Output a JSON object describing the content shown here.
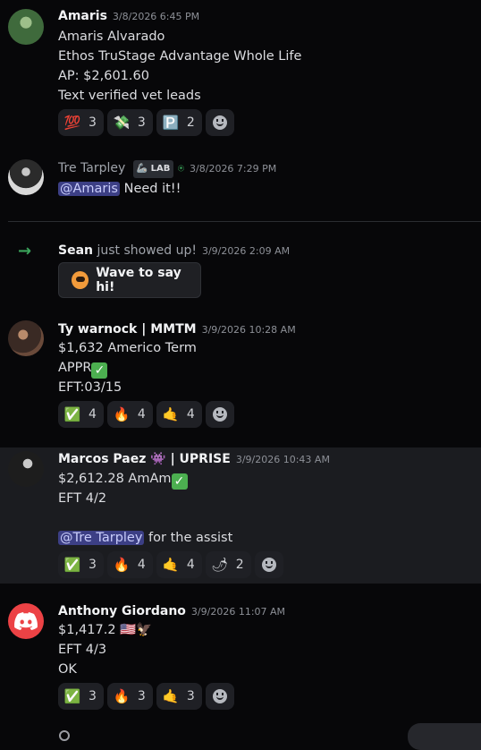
{
  "messages": [
    {
      "author": "Amaris",
      "timestamp": "3/8/2026 6:45 PM",
      "lines": [
        "Amaris Alvarado",
        "Ethos TruStage Advantage Whole Life",
        "AP: $2,601.60",
        "Text verified vet leads"
      ],
      "reactions": [
        {
          "emoji": "💯",
          "count": "3"
        },
        {
          "emoji": "💸",
          "count": "3"
        },
        {
          "emoji": "🅿️",
          "count": "2"
        }
      ]
    },
    {
      "author": "Tre Tarpley",
      "tag": "LAB",
      "timestamp": "3/8/2026 7:29 PM",
      "mention": "@Amaris",
      "text": "Need it!!"
    },
    {
      "author": "Sean",
      "system_text": "just showed up!",
      "timestamp": "3/9/2026 2:09 AM",
      "wave_button": "Wave to say hi!"
    },
    {
      "author": "Ty warnock | MMTM",
      "timestamp": "3/9/2026 10:28 AM",
      "lines": [
        "$1,632 Americo Term",
        "APPR",
        "EFT:03/15"
      ],
      "reactions": [
        {
          "emoji": "✅",
          "count": "4"
        },
        {
          "emoji": "🔥",
          "count": "4"
        },
        {
          "emoji": "🤙",
          "count": "4"
        }
      ]
    },
    {
      "author": "Marcos Paez 👾 | UPRISE",
      "timestamp": "3/9/2026 10:43 AM",
      "lines": [
        "$2,612.28 AmAm",
        "EFT 4/2"
      ],
      "mention": "@Tre Tarpley",
      "mention_suffix": "for the assist",
      "reactions": [
        {
          "emoji": "✅",
          "count": "3"
        },
        {
          "emoji": "🔥",
          "count": "4"
        },
        {
          "emoji": "🤙",
          "count": "4"
        },
        {
          "emoji": "🌶",
          "count": "2"
        }
      ]
    },
    {
      "author": "Anthony Giordano",
      "timestamp": "3/9/2026 11:07 AM",
      "lines": [
        "$1,417.2 🇺🇸🦅",
        "EFT 4/3",
        "OK"
      ],
      "reactions": [
        {
          "emoji": "✅",
          "count": "3"
        },
        {
          "emoji": "🔥",
          "count": "3"
        },
        {
          "emoji": "🤙",
          "count": "3"
        }
      ]
    }
  ],
  "colors": {
    "background": "#070709",
    "highlight_row": "#1b1c20",
    "mention_bg": "#3c3f85",
    "join_arrow": "#3ba55c",
    "discord_red": "#ec4245"
  },
  "icons": {
    "add_reaction": "smile-plus-icon",
    "join": "arrow-right-icon",
    "wave": "wave-sticker-icon",
    "default_avatar": "discord-logo-icon"
  }
}
